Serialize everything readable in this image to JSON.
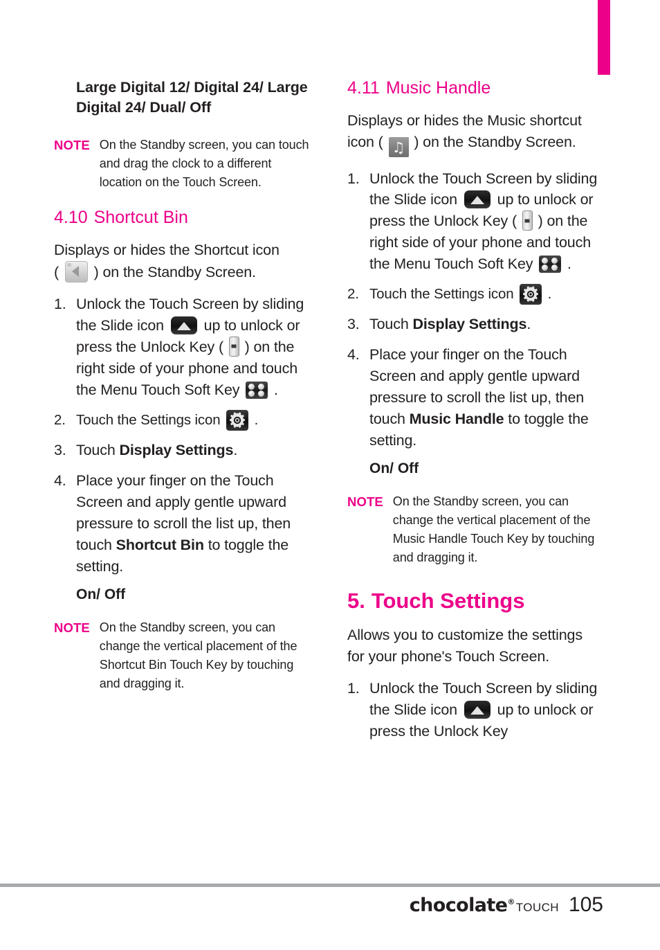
{
  "page": {
    "number": "105",
    "brand": "chocolate",
    "brand_mark": "®",
    "brand_sub": "TOUCH",
    "accent_color": "#ec0089",
    "rule_color": "#a7a9ac"
  },
  "left_column": {
    "subtitle": "Large Digital 12/ Digital 24/ Large Digital 24/ Dual/ Off",
    "note_top": {
      "label": "NOTE",
      "text": "On the Standby screen, you can touch and drag the clock to a different location on the Touch Screen."
    },
    "section": {
      "number": "4.10",
      "title": "Shortcut Bin"
    },
    "intro_before_icon": "Displays or hides the Shortcut icon",
    "intro_open_paren": "(",
    "intro_after_icon": ") on the Standby Screen.",
    "steps": [
      {
        "marker": "1.",
        "part1": "Unlock the Touch Screen by sliding the Slide icon",
        "part2": "up to unlock or press the Unlock Key (",
        "part3": ") on the right side of your phone and touch the Menu Touch Soft Key",
        "part4": "."
      },
      {
        "marker": "2.",
        "part1": "Touch the Settings icon",
        "part2": "."
      },
      {
        "marker": "3.",
        "pre": "Touch ",
        "bold": "Display Settings",
        "post": "."
      },
      {
        "marker": "4.",
        "pre": "Place your finger on the Touch Screen and apply gentle upward pressure to scroll the list up, then touch ",
        "bold": "Shortcut Bin",
        "post": " to toggle the setting."
      }
    ],
    "onoff": "On/ Off",
    "note_bottom": {
      "label": "NOTE",
      "text": "On the Standby screen, you can change the vertical placement of the Shortcut Bin Touch Key by touching and dragging it."
    }
  },
  "right_column": {
    "section": {
      "number": "4.11",
      "title": "Music Handle"
    },
    "intro_before_icon": "Displays or hides the Music shortcut icon (",
    "intro_after_icon": ") on the Standby Screen.",
    "steps": [
      {
        "marker": "1.",
        "part1": "Unlock the Touch Screen by sliding the Slide icon",
        "part2": "up to unlock or press the Unlock Key (",
        "part3": ") on the right side of your phone and touch the Menu Touch Soft Key",
        "part4": "."
      },
      {
        "marker": "2.",
        "part1": "Touch the Settings icon",
        "part2": "."
      },
      {
        "marker": "3.",
        "pre": "Touch ",
        "bold": "Display Settings",
        "post": "."
      },
      {
        "marker": "4.",
        "pre": "Place your finger on the Touch Screen and apply gentle upward pressure to scroll the list up, then touch ",
        "bold": "Music Handle",
        "post": " to toggle the setting."
      }
    ],
    "onoff": "On/ Off",
    "note": {
      "label": "NOTE",
      "text": "On the Standby screen, you can change the vertical placement of the Music Handle Touch Key by touching and dragging it."
    },
    "section2": {
      "number": "5.",
      "title": "Touch Settings"
    },
    "intro2": "Allows you to customize the settings for your phone's Touch Screen.",
    "steps2": [
      {
        "marker": "1.",
        "part1": "Unlock the Touch Screen by sliding the Slide icon",
        "part2": "up to unlock or press the Unlock Key"
      }
    ]
  },
  "icons": {
    "slide": "slide-up-icon",
    "unlock_key": "unlock-key-icon",
    "menu_soft_key": "menu-soft-key-icon",
    "settings": "settings-gear-icon",
    "shortcut_bin": "shortcut-bin-icon",
    "music": "music-note-icon",
    "music_glyph": "♫"
  }
}
